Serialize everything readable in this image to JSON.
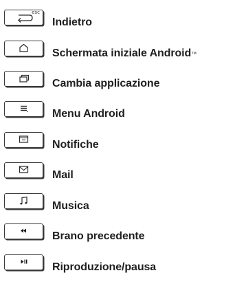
{
  "keys": [
    {
      "label": "Indietro",
      "icon": "back-arrow-icon",
      "sub_label": "esc"
    },
    {
      "label": "Schermata iniziale Android",
      "trademark": "™",
      "icon": "home-icon"
    },
    {
      "label": "Cambia applicazione",
      "icon": "switch-app-icon"
    },
    {
      "label": "Menu Android",
      "icon": "menu-icon"
    },
    {
      "label": "Notifiche",
      "icon": "notifications-icon"
    },
    {
      "label": "Mail",
      "icon": "mail-icon"
    },
    {
      "label": "Musica",
      "icon": "music-note-icon"
    },
    {
      "label": "Brano precedente",
      "icon": "previous-track-icon"
    },
    {
      "label": "Riproduzione/pausa",
      "icon": "play-pause-icon"
    }
  ]
}
